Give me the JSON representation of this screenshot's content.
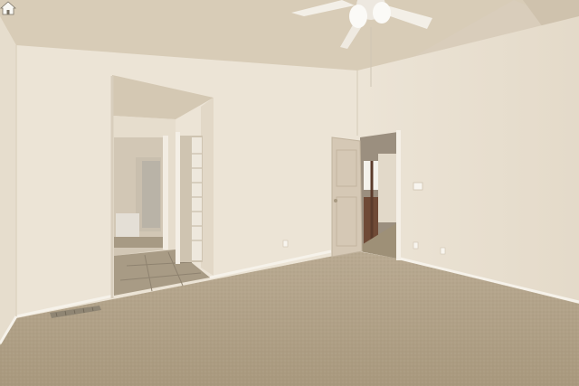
{
  "photo": {
    "subject": "empty-bedroom",
    "features": [
      "vaulted-ceiling",
      "ceiling-fan-with-light",
      "carpet-floor",
      "walk-in-closet",
      "ensuite-bathroom",
      "open-door-to-hallway",
      "floor-vent",
      "baseboard-trim",
      "light-switch",
      "electrical-outlets"
    ],
    "colors": {
      "wall": "#ece4d6",
      "ceiling": "#d9cdb8",
      "carpet": "#b7a78e",
      "door": "#d4c7b4",
      "trim": "#f6f2ea",
      "tile": "#a79a84"
    }
  },
  "watermark": {
    "icon": "home-icon"
  }
}
